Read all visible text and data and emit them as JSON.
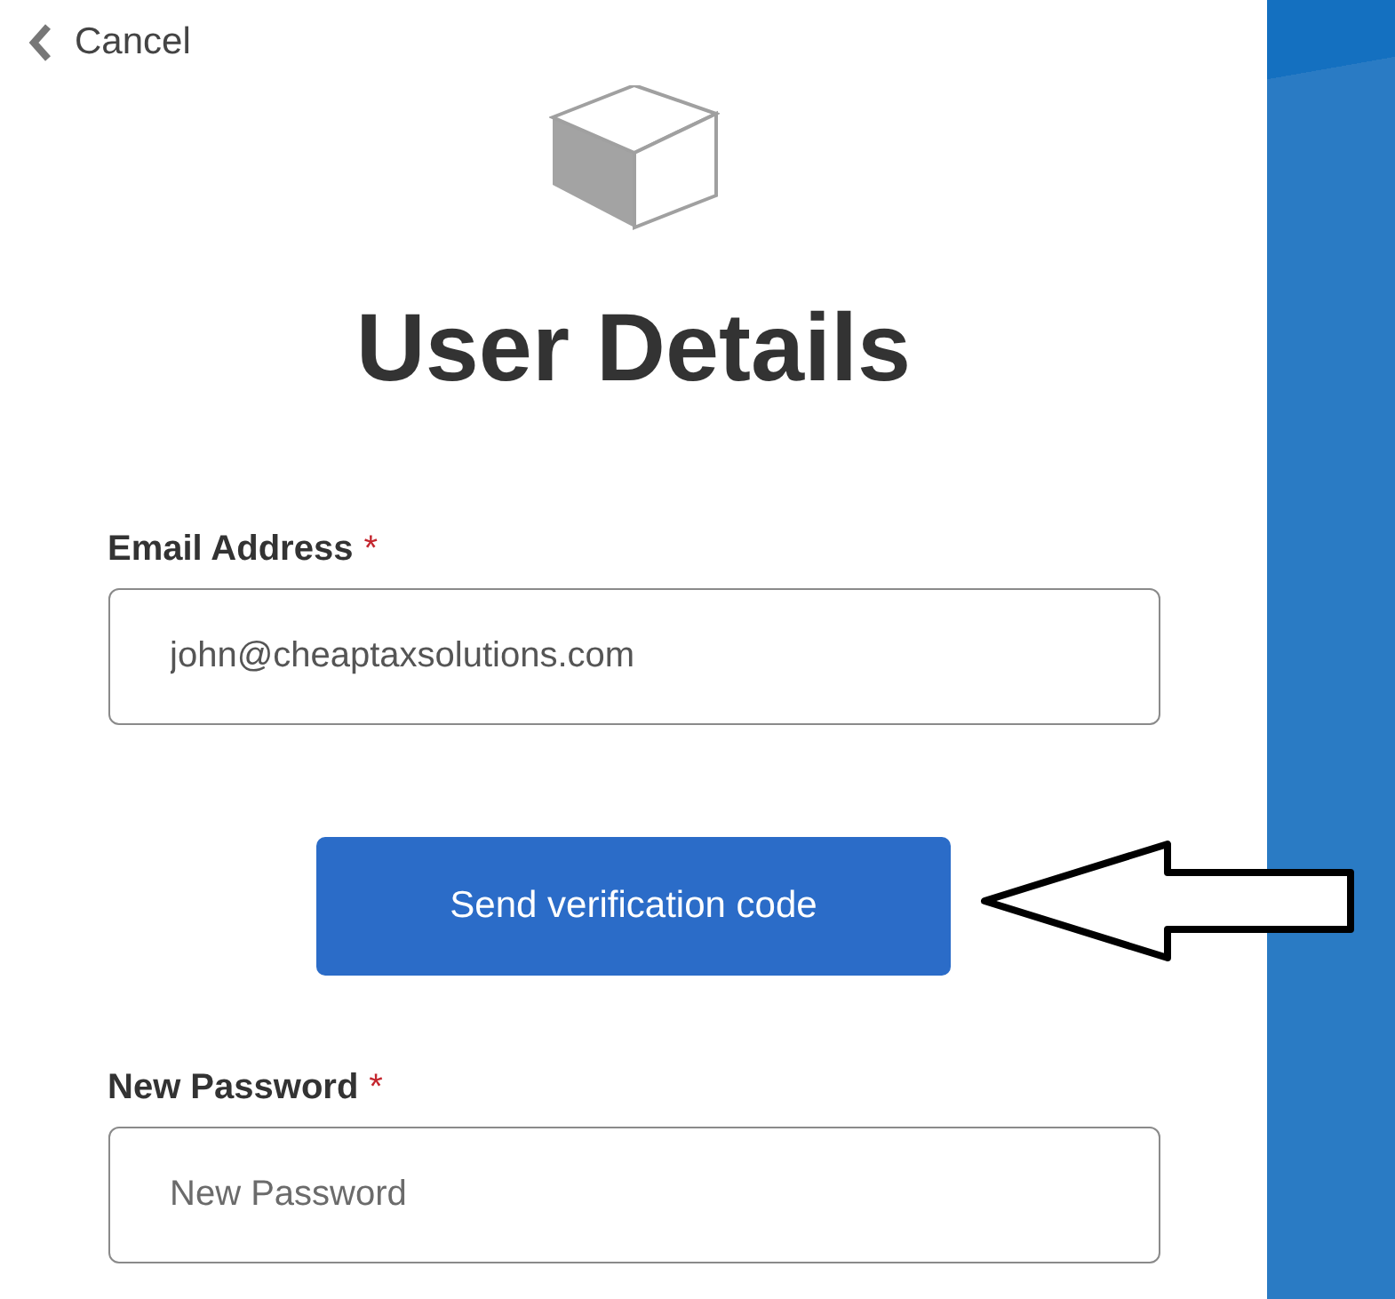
{
  "cancel_link": {
    "label": "Cancel"
  },
  "title": "User Details",
  "fields": [
    {
      "label": "Email Address",
      "required_mark": "*",
      "value": "john@cheaptaxsolutions.com"
    },
    {
      "label": "New Password",
      "required_mark": "*",
      "placeholder": "New Password"
    }
  ],
  "send_button": {
    "label": "Send verification code"
  }
}
